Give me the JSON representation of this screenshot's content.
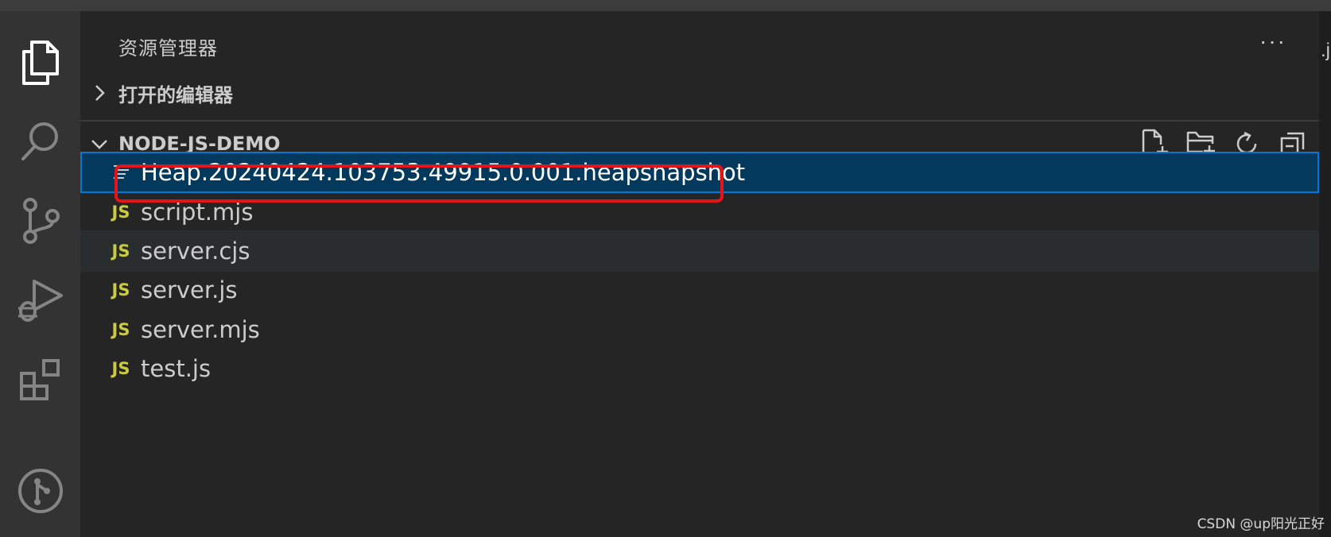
{
  "explorer": {
    "title": "资源管理器",
    "more_actions": "···",
    "open_editors_label": "打开的编辑器",
    "folder_label": "NODE-JS-DEMO",
    "files": [
      {
        "name": "Heap.20240424.103753.49915.0.001.heapsnapshot",
        "icon": "text-file-icon",
        "icon_label": ""
      },
      {
        "name": "script.mjs",
        "icon": "js-icon",
        "icon_label": "JS"
      },
      {
        "name": "server.cjs",
        "icon": "js-icon",
        "icon_label": "JS"
      },
      {
        "name": "server.js",
        "icon": "js-icon",
        "icon_label": "JS"
      },
      {
        "name": "server.mjs",
        "icon": "js-icon",
        "icon_label": "JS"
      },
      {
        "name": "test.js",
        "icon": "js-icon",
        "icon_label": "JS"
      }
    ]
  },
  "editor_tab_fragment": ".j",
  "watermark": "CSDN @up阳光正好",
  "colors": {
    "selection_bg": "#04395e",
    "selection_border": "#0078d4",
    "annotation_red": "#e4141b",
    "js_yellow": "#cbcb41"
  }
}
